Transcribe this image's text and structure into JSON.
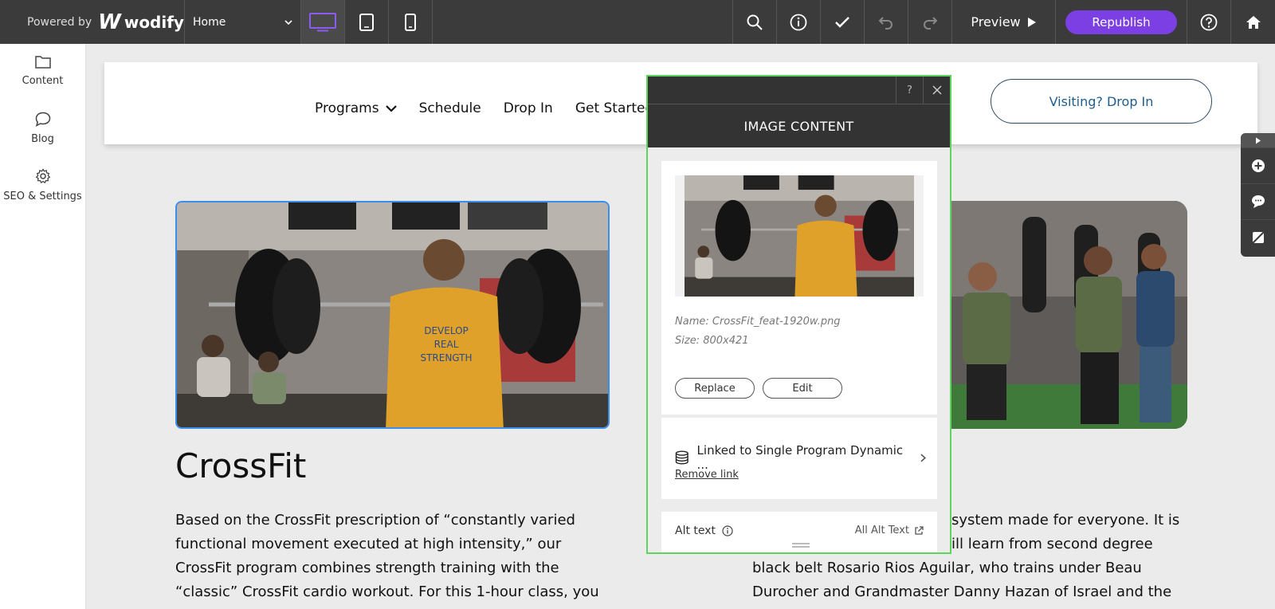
{
  "topbar": {
    "powered_by": "Powered by",
    "brand_name": "wodify",
    "page_select": "Home",
    "preview_label": "Preview",
    "republish_label": "Republish"
  },
  "sidebar": {
    "items": [
      {
        "label": "Content",
        "icon": "folder-icon"
      },
      {
        "label": "Blog",
        "icon": "chat-bubble-icon"
      },
      {
        "label": "SEO & Settings",
        "icon": "gear-icon"
      }
    ]
  },
  "site": {
    "nav": [
      "Programs",
      "Schedule",
      "Drop In",
      "Get Started"
    ],
    "dropin_button": "Visiting? Drop In",
    "section_title": "CrossFit",
    "paragraph_left": "Based on the CrossFit prescription of “constantly varied functional movement executed at high intensity,” our CrossFit program combines strength training with the “classic” CrossFit cardio workout. For this 1-hour class, you",
    "paragraph_right_lines": [
      "system made for everyone. It is",
      "ill learn from second degree",
      "black belt Rosario Rios Aguilar, who trains under Beau",
      "Durocher and Grandmaster Danny Hazan of Israel and the"
    ],
    "shirt_text": "DEVELOP REAL STRENGTH"
  },
  "panel": {
    "help": "?",
    "title": "IMAGE CONTENT",
    "name": "Name: CrossFit_feat-1920w.png",
    "size": "Size: 800x421",
    "replace_label": "Replace",
    "edit_label": "Edit",
    "linked_label": "Linked to Single Program Dynamic ...",
    "remove_link": "Remove link",
    "alt_text_label": "Alt text",
    "all_alt_text": "All Alt Text"
  },
  "colors": {
    "topbar": "#3b3b3b",
    "accent": "#7b3fe4",
    "selection": "#3a8ef0",
    "panel_border": "#5fd35f"
  }
}
